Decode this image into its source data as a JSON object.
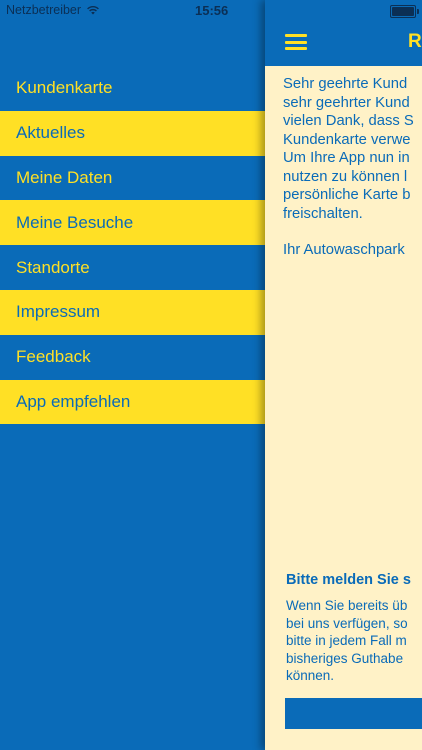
{
  "status_bar": {
    "carrier": "Netzbetreiber",
    "time": "15:56"
  },
  "sidebar": {
    "items": [
      {
        "label": "Kundenkarte"
      },
      {
        "label": "Aktuelles"
      },
      {
        "label": "Meine Daten"
      },
      {
        "label": "Meine Besuche"
      },
      {
        "label": "Standorte"
      },
      {
        "label": "Impressum"
      },
      {
        "label": "Feedback"
      },
      {
        "label": "App empfehlen"
      }
    ]
  },
  "main": {
    "nav_title": "R",
    "intro_lines": [
      "Sehr geehrte Kund",
      "sehr geehrter Kund",
      "vielen Dank, dass S",
      "Kundenkarte verwe",
      "Um Ihre App nun in",
      "nutzen zu können l",
      "persönliche Karte b",
      "freischalten."
    ],
    "signature": "Ihr Autowaschpark",
    "login_heading": "Bitte melden Sie s",
    "login_lines": [
      "Wenn Sie bereits üb",
      "bei uns verfügen, so",
      "bitte in jedem Fall m",
      "bisheriges Guthabe",
      "können."
    ]
  },
  "colors": {
    "brand_blue": "#0a6bb8",
    "brand_yellow": "#ffe025",
    "content_bg": "#fff2c7"
  }
}
